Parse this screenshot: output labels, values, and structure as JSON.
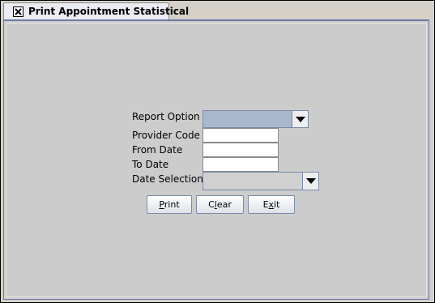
{
  "window": {
    "tab_title": "Print Appointment Statistical",
    "close_icon": "close-x-icon"
  },
  "form": {
    "report_option": {
      "label": "Report Option",
      "value": ""
    },
    "provider_code": {
      "label": "Provider Code",
      "value": ""
    },
    "from_date": {
      "label": "From Date",
      "value": ""
    },
    "to_date": {
      "label": "To Date",
      "value": ""
    },
    "date_selection": {
      "label": "Date Selection",
      "value": ""
    }
  },
  "buttons": {
    "print": {
      "mnemonic": "P",
      "rest": "rint"
    },
    "clear": {
      "pre": "C",
      "mnemonic": "l",
      "rest": "ear"
    },
    "exit": {
      "pre": "E",
      "mnemonic": "x",
      "rest": "it"
    }
  },
  "colors": {
    "report_option_fill": "#a9b8cc",
    "date_selection_fill": "#d0d0d0",
    "panel_border": "#6d7aa6"
  }
}
